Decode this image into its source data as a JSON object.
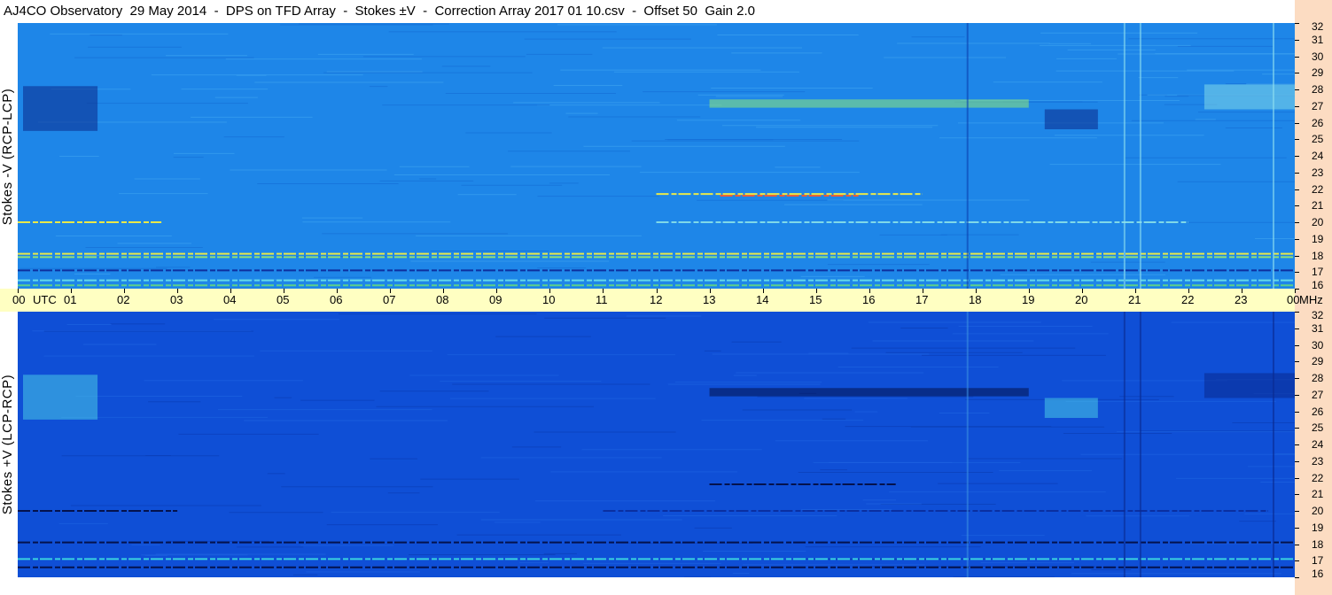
{
  "header": {
    "title": "AJ4CO Observatory  29 May 2014  -  DPS on TFD Array  -  Stokes ±V  -  Correction Array 2017 01 10.csv  -  Offset 50  Gain 2.0"
  },
  "chart_data": [
    {
      "type": "heatmap",
      "panel": "top",
      "ylabel": "Stokes -V (RCP-LCP)",
      "xlabel": "UTC",
      "x_ticks": [
        "00",
        "01",
        "02",
        "03",
        "04",
        "05",
        "06",
        "07",
        "08",
        "09",
        "10",
        "11",
        "12",
        "13",
        "14",
        "15",
        "16",
        "17",
        "18",
        "19",
        "20",
        "21",
        "22",
        "23",
        "00"
      ],
      "xlim": [
        0,
        24
      ],
      "y_unit": "MHz",
      "y_ticks": [
        16,
        17,
        18,
        19,
        20,
        21,
        22,
        23,
        24,
        25,
        26,
        27,
        28,
        29,
        30,
        31,
        32
      ],
      "ylim": [
        16,
        32
      ],
      "background_color": "#1e86e8",
      "features": [
        {
          "kind": "band",
          "t0": 0,
          "t1": 24,
          "f": 18.1,
          "color": "#e8e84a"
        },
        {
          "kind": "band",
          "t0": 0,
          "t1": 24,
          "f": 17.9,
          "color": "#8fe07a"
        },
        {
          "kind": "band",
          "t0": 0,
          "t1": 24,
          "f": 17.1,
          "color": "#0d2f9e"
        },
        {
          "kind": "band",
          "t0": 0,
          "t1": 24,
          "f": 16.5,
          "color": "#66d9e8"
        },
        {
          "kind": "band",
          "t0": 0,
          "t1": 24,
          "f": 16.2,
          "color": "#5ccf8a"
        },
        {
          "kind": "band",
          "t0": 13.2,
          "t1": 15.8,
          "f": 21.6,
          "color": "#e85a3a"
        },
        {
          "kind": "band",
          "t0": 12.0,
          "t1": 17.0,
          "f": 21.7,
          "color": "#e8e84a"
        },
        {
          "kind": "band",
          "t0": 0,
          "t1": 2.7,
          "f": 20.0,
          "color": "#e8e84a"
        },
        {
          "kind": "band",
          "t0": 12.0,
          "t1": 22.0,
          "f": 20.0,
          "color": "#7fd8e8"
        },
        {
          "kind": "patch",
          "t0": 0.1,
          "t1": 1.5,
          "f0": 25.5,
          "f1": 28.2,
          "color": "#0b2a8a"
        },
        {
          "kind": "patch",
          "t0": 13.0,
          "t1": 19.0,
          "f0": 26.9,
          "f1": 27.4,
          "color": "#8ee87a"
        },
        {
          "kind": "patch",
          "t0": 19.3,
          "t1": 20.3,
          "f0": 25.6,
          "f1": 26.8,
          "color": "#0b2a8a"
        },
        {
          "kind": "patch",
          "t0": 22.3,
          "t1": 24.0,
          "f0": 26.8,
          "f1": 28.3,
          "color": "#7fd8e8"
        },
        {
          "kind": "vline",
          "t": 17.85,
          "color": "#0b3fb0"
        },
        {
          "kind": "vline",
          "t": 20.8,
          "color": "#8fe0f0"
        },
        {
          "kind": "vline",
          "t": 21.1,
          "color": "#8fe0f0"
        },
        {
          "kind": "vline",
          "t": 23.6,
          "color": "#8fe0f0"
        }
      ]
    },
    {
      "type": "heatmap",
      "panel": "bottom",
      "ylabel": "Stokes +V (LCP-RCP)",
      "xlabel": "UTC",
      "x_ticks": [
        "00",
        "01",
        "02",
        "03",
        "04",
        "05",
        "06",
        "07",
        "08",
        "09",
        "10",
        "11",
        "12",
        "13",
        "14",
        "15",
        "16",
        "17",
        "18",
        "19",
        "20",
        "21",
        "22",
        "23",
        "00"
      ],
      "xlim": [
        0,
        24
      ],
      "y_unit": "MHz",
      "y_ticks": [
        16,
        17,
        18,
        19,
        20,
        21,
        22,
        23,
        24,
        25,
        26,
        27,
        28,
        29,
        30,
        31,
        32
      ],
      "ylim": [
        16,
        32
      ],
      "background_color": "#0f4fd6",
      "features": [
        {
          "kind": "band",
          "t0": 0,
          "t1": 24,
          "f": 18.1,
          "color": "#04124d"
        },
        {
          "kind": "band",
          "t0": 0,
          "t1": 24,
          "f": 17.1,
          "color": "#3ad2e0"
        },
        {
          "kind": "band",
          "t0": 0,
          "t1": 24,
          "f": 16.6,
          "color": "#04124d"
        },
        {
          "kind": "band",
          "t0": 13.0,
          "t1": 16.5,
          "f": 21.6,
          "color": "#04124d"
        },
        {
          "kind": "band",
          "t0": 0,
          "t1": 3.0,
          "f": 20.0,
          "color": "#04124d"
        },
        {
          "kind": "band",
          "t0": 11.0,
          "t1": 23.5,
          "f": 20.0,
          "color": "#0a2fa0"
        },
        {
          "kind": "patch",
          "t0": 0.1,
          "t1": 1.5,
          "f0": 25.5,
          "f1": 28.2,
          "color": "#48c8e6"
        },
        {
          "kind": "patch",
          "t0": 13.0,
          "t1": 19.0,
          "f0": 26.9,
          "f1": 27.4,
          "color": "#04124d"
        },
        {
          "kind": "patch",
          "t0": 19.3,
          "t1": 20.3,
          "f0": 25.6,
          "f1": 26.8,
          "color": "#48c8e6"
        },
        {
          "kind": "patch",
          "t0": 22.3,
          "t1": 24.0,
          "f0": 26.8,
          "f1": 28.3,
          "color": "#0a2a90"
        },
        {
          "kind": "vline",
          "t": 17.85,
          "color": "#3a8fe0"
        },
        {
          "kind": "vline",
          "t": 20.8,
          "color": "#0a2a90"
        },
        {
          "kind": "vline",
          "t": 21.1,
          "color": "#0a2a90"
        },
        {
          "kind": "vline",
          "t": 23.6,
          "color": "#0a2a90"
        }
      ]
    }
  ],
  "axis": {
    "utc_label": "UTC",
    "mhz_label": "MHz"
  },
  "colors": {
    "utc_band": "#ffffc2",
    "freq_strip": "#fcdcc2"
  }
}
